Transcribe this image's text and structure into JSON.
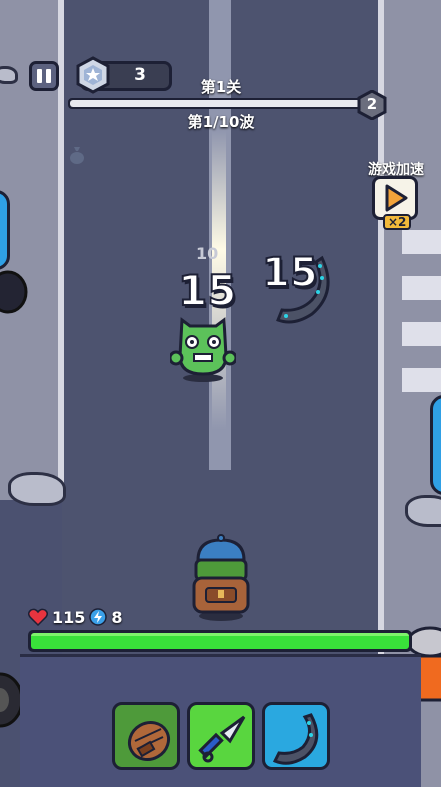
{
  "hud": {
    "gem_count": "3",
    "level_title": "第1关",
    "wave_text": "第1/10波",
    "wave_progress": 0.98,
    "next_level_badge": "2",
    "speed_label": "游戏加速",
    "speed_multiplier": "×2"
  },
  "combat": {
    "damage_numbers": [
      "15",
      "15"
    ],
    "faded_damage": "10"
  },
  "player": {
    "hp": "115",
    "shield": "8",
    "hp_fraction": 1.0
  },
  "skills": [
    {
      "name": "backpack",
      "color": "#4e9a3a"
    },
    {
      "name": "kunai",
      "color": "#59d63f"
    },
    {
      "name": "boomerang",
      "color": "#2aa8e0"
    }
  ],
  "colors": {
    "health": "#39e13a",
    "heart": "#e8343f",
    "shield": "#3aa0e8",
    "speed_button": "#f2a33a"
  },
  "icons": [
    "pause-icon",
    "gem-icon",
    "money-bag-icon",
    "play-icon",
    "heart-icon",
    "shield-icon",
    "backpack-icon",
    "kunai-icon",
    "boomerang-icon"
  ]
}
